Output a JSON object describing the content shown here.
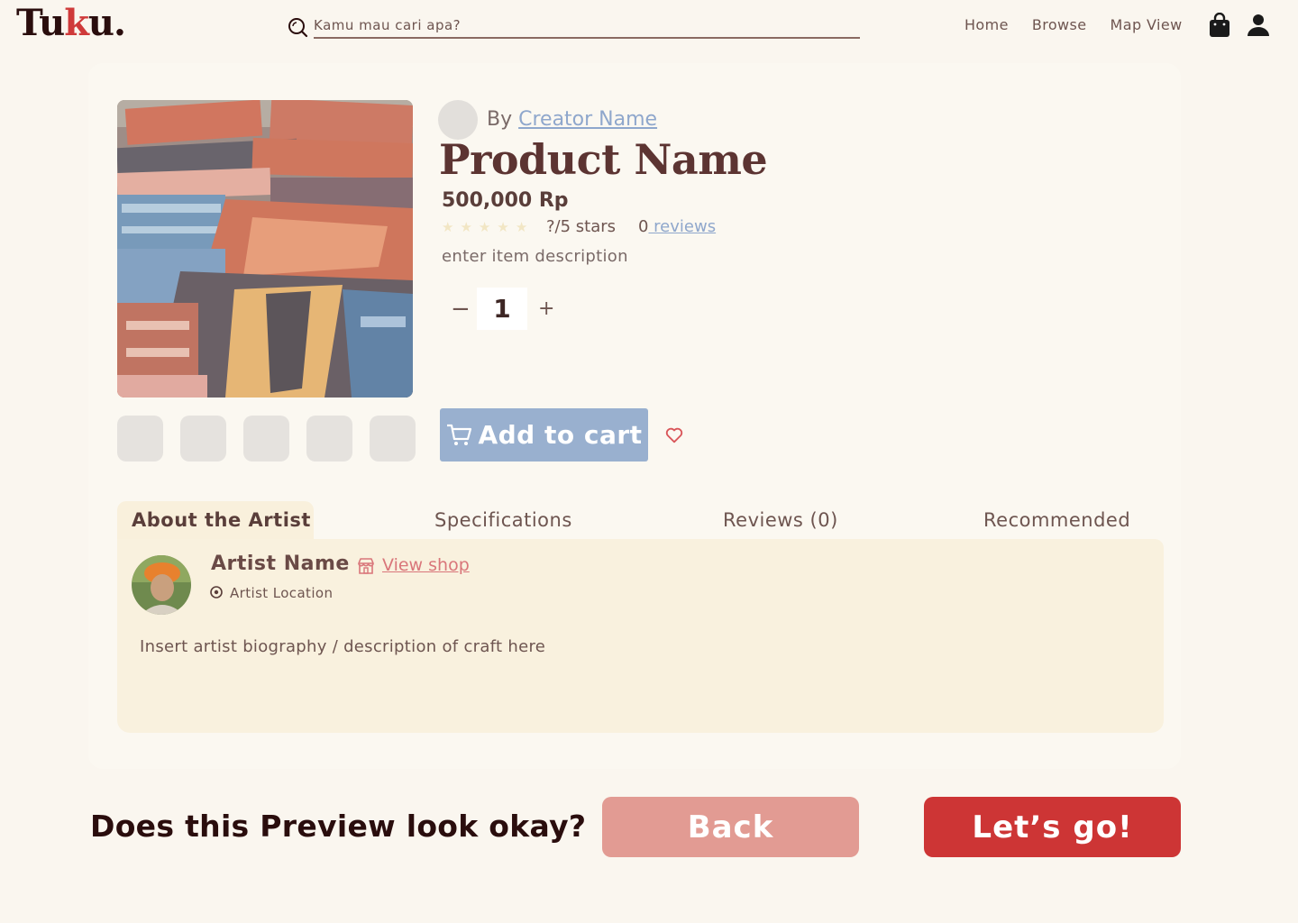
{
  "header": {
    "logo_parts": [
      "Tu",
      "k",
      "u."
    ],
    "search_placeholder": "Kamu mau cari apa?",
    "nav": [
      "Home",
      "Browse",
      "Map View"
    ]
  },
  "product": {
    "by_prefix": "By ",
    "creator_name": "Creator Name",
    "name": "Product Name",
    "price": "500,000 Rp",
    "rating_stars": 0,
    "rating_text": "?/5 stars",
    "review_count": "0",
    "reviews_label": " reviews",
    "description": "enter item description",
    "quantity": "1",
    "minus_glyph": "−",
    "plus_glyph": "+",
    "add_to_cart": "Add to cart"
  },
  "tabs": [
    "About the Artist",
    "Specifications",
    "Reviews (0)",
    "Recommended"
  ],
  "artist": {
    "name": "Artist Name",
    "view_shop": "View shop",
    "location": "Artist Location",
    "bio": "Insert artist biography / description of craft here"
  },
  "footer": {
    "question": "Does this Preview look okay?",
    "back": "Back",
    "go": "Let’s go!"
  },
  "colors": {
    "background": "#faf6ef",
    "brand_dark": "#2a0d0d",
    "accent_red": "#cd3535",
    "back_pink": "#e29b93",
    "cart_blue": "#99b0cf",
    "panel_cream": "#f9f1de"
  }
}
